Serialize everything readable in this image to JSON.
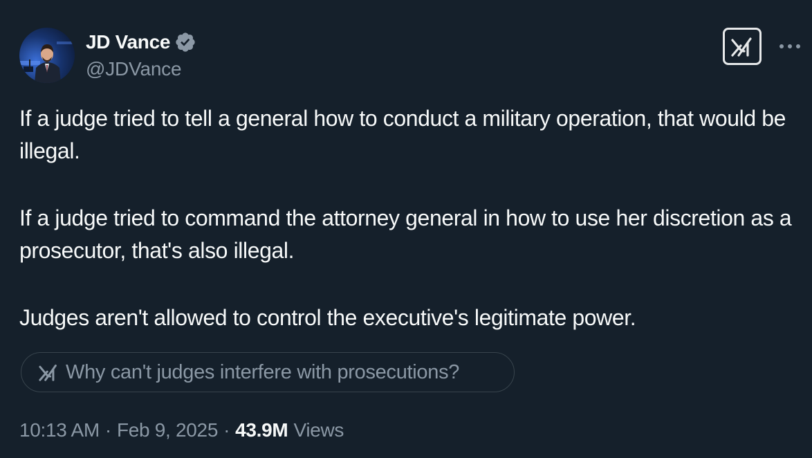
{
  "author": {
    "display_name": "JD Vance",
    "handle": "@JDVance",
    "verified_icon": "verified-badge-icon",
    "avatar": "avatar-photo"
  },
  "toolbar": {
    "grok_icon": "grok-icon",
    "more_icon": "more-options-icon"
  },
  "tweet": {
    "paragraphs": [
      "If a judge tried to tell a general how to conduct a military operation, that would be illegal.",
      "If a judge tried to command the attorney general in how to use her discretion as a prosecutor, that's also illegal.",
      "Judges aren't allowed to control the executive's legitimate power."
    ]
  },
  "grok_prompt": {
    "icon": "grok-icon",
    "label": "Why can't judges interfere with prosecutions?"
  },
  "meta": {
    "time": "10:13 AM",
    "separator": "·",
    "date": "Feb 9, 2025",
    "views_count": "43.9M",
    "views_label": "Views"
  },
  "colors": {
    "background": "#15202b",
    "text_primary": "#f7f9f9",
    "text_secondary": "#8b98a5",
    "border": "#38444d",
    "verified": "#8b98a5"
  }
}
